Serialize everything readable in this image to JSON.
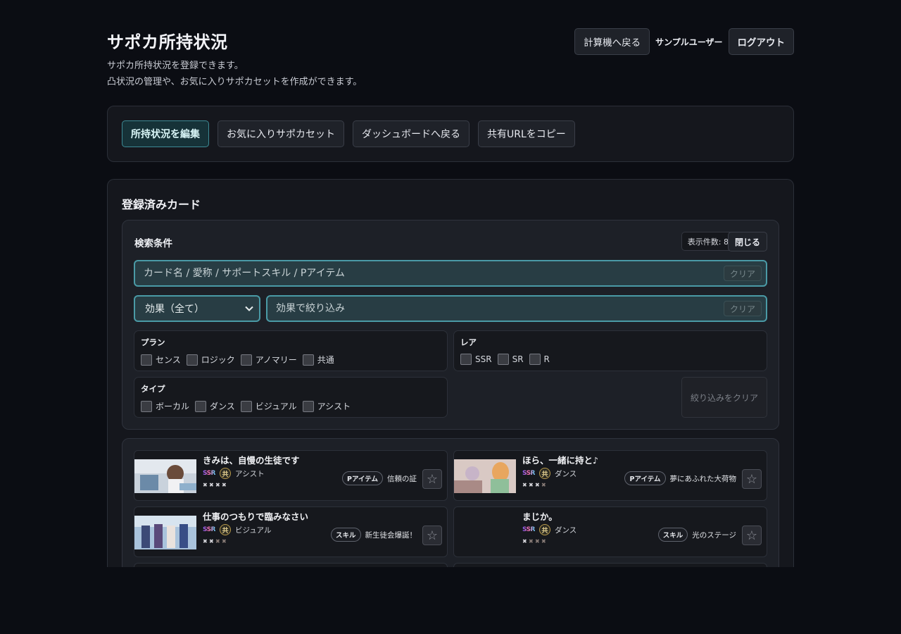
{
  "header": {
    "title": "サポカ所持状況",
    "desc1": "サポカ所持状況を登録できます。",
    "desc2": "凸状況の管理や、お気に入りサポカセットを作成ができます。",
    "back_calc": "計算機へ戻る",
    "user": "サンプルユーザー",
    "logout": "ログアウト"
  },
  "toolbar": {
    "edit": "所持状況を編集",
    "favorites": "お気に入りサポカセット",
    "dashboard": "ダッシュボードへ戻る",
    "copy_url": "共有URLをコピー"
  },
  "cards_section": {
    "title": "登録済みカード",
    "search": {
      "title": "検索条件",
      "count": "表示件数: 8",
      "close": "閉じる",
      "placeholder": "カード名 / 愛称 / サポートスキル / Pアイテム",
      "clear": "クリア",
      "effect_select": "効果（全て）",
      "effect_placeholder": "効果で絞り込み",
      "plan_title": "プラン",
      "plan_options": [
        "センス",
        "ロジック",
        "アノマリー",
        "共通"
      ],
      "rare_title": "レア",
      "rare_options": [
        "SSR",
        "SR",
        "R"
      ],
      "type_title": "タイプ",
      "type_options": [
        "ボーカル",
        "ダンス",
        "ビジュアル",
        "アシスト"
      ],
      "clear_filters": "絞り込みをクリア"
    },
    "cards": [
      {
        "name": "きみは、自慢の生徒です",
        "rarity": "SSR",
        "plan": "共",
        "type": "アシスト",
        "uncap": 4,
        "tag": "Pアイテム",
        "effect": "信頼の証"
      },
      {
        "name": "ほら、一緒に持と♪",
        "rarity": "SSR",
        "plan": "共",
        "type": "ダンス",
        "uncap": 3,
        "tag": "Pアイテム",
        "effect": "夢にあふれた大荷物"
      },
      {
        "name": "仕事のつもりで臨みなさい",
        "rarity": "SSR",
        "plan": "共",
        "type": "ビジュアル",
        "uncap": 2,
        "tag": "スキル",
        "effect": "新生徒会爆誕！"
      },
      {
        "name": "まじか。",
        "rarity": "SSR",
        "plan": "共",
        "type": "ダンス",
        "uncap": 1,
        "tag": "スキル",
        "effect": "光のステージ"
      }
    ]
  },
  "icons": {
    "favorite": "star-outline-icon",
    "uncap": "cross-icon",
    "dropdown": "chevron-down-icon"
  },
  "colors": {
    "accent": "#4a9aa6",
    "background": "#0b0d13",
    "panel": "#15171d"
  }
}
